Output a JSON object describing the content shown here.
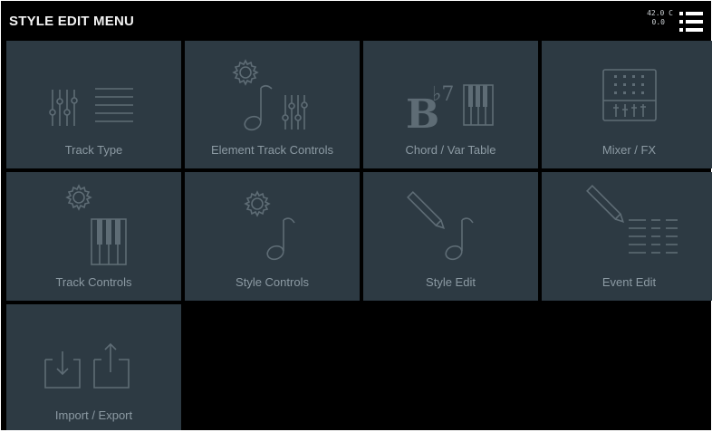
{
  "header": {
    "title": "STYLE EDIT MENU",
    "status_line1": "42.0 C",
    "status_line2": "0.0"
  },
  "tiles": [
    {
      "label": "Track Type",
      "icon": "track-type-icon"
    },
    {
      "label": "Element Track Controls",
      "icon": "element-track-controls-icon"
    },
    {
      "label": "Chord / Var Table",
      "icon": "chord-var-table-icon",
      "chord_text": "B",
      "chord_sup": "♭7"
    },
    {
      "label": "Mixer / FX",
      "icon": "mixer-icon"
    },
    {
      "label": "Track Controls",
      "icon": "track-controls-icon"
    },
    {
      "label": "Style Controls",
      "icon": "style-controls-icon"
    },
    {
      "label": "Style Edit",
      "icon": "style-edit-icon"
    },
    {
      "label": "Event Edit",
      "icon": "event-edit-icon"
    },
    {
      "label": "Import / Export",
      "icon": "import-export-icon"
    }
  ],
  "colors": {
    "background": "#000000",
    "tile": "#2d3a43",
    "icon_stroke": "#5e6c75",
    "label": "#8c9aa3",
    "title": "#f2f2f2"
  }
}
